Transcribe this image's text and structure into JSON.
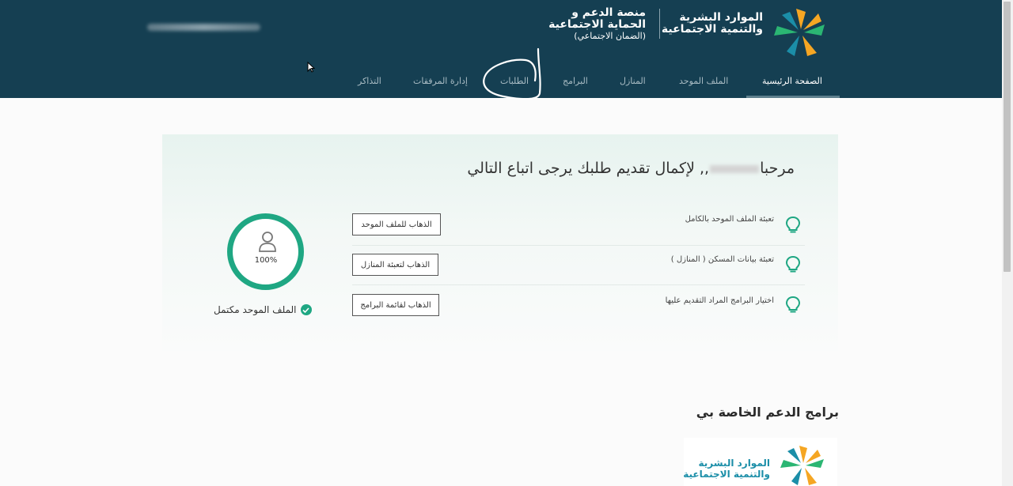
{
  "header": {
    "ministry_line1": "الموارد البشرية",
    "ministry_line2": "والتنمية الاجتماعية",
    "platform_line1": "منصة الدعم و",
    "platform_line2": "الحماية الاجتماعية",
    "platform_line3": "(الضمان الاجتماعي)",
    "nav": [
      "الصفحة الرئيسية",
      "الملف الموحد",
      "المنازل",
      "البرامج",
      "الطلبات",
      "إدارة المرفقات",
      "التذاكر"
    ],
    "active_nav": "الصفحة الرئيسية"
  },
  "welcome": {
    "prefix": "مرحبا",
    "suffix": ",, لإكمال تقديم طلبك يرجى اتباع التالي"
  },
  "steps": [
    {
      "text": "تعبئة الملف الموحد بالكامل",
      "button": "الذهاب للملف الموحد"
    },
    {
      "text": "تعبئة بيانات المسكن ( المنازل )",
      "button": "الذهاب لتعبئة المنازل"
    },
    {
      "text": "اختيار البرامج المراد التقديم عليها",
      "button": "الذهاب لقائمة البرامج"
    }
  ],
  "profile": {
    "progress_percent": 100,
    "progress_label": "100%",
    "status": "الملف الموحد مكتمل"
  },
  "programs": {
    "title": "برامج الدعم الخاصة بي",
    "card_line1": "الموارد البشرية",
    "card_line2": "والتنمية الاجتماعية"
  },
  "colors": {
    "header_bg": "#153f52",
    "accent_green": "#1fa783",
    "logo_orange": "#f5a623",
    "logo_green": "#2bb673",
    "logo_blue": "#1b8ea8"
  }
}
